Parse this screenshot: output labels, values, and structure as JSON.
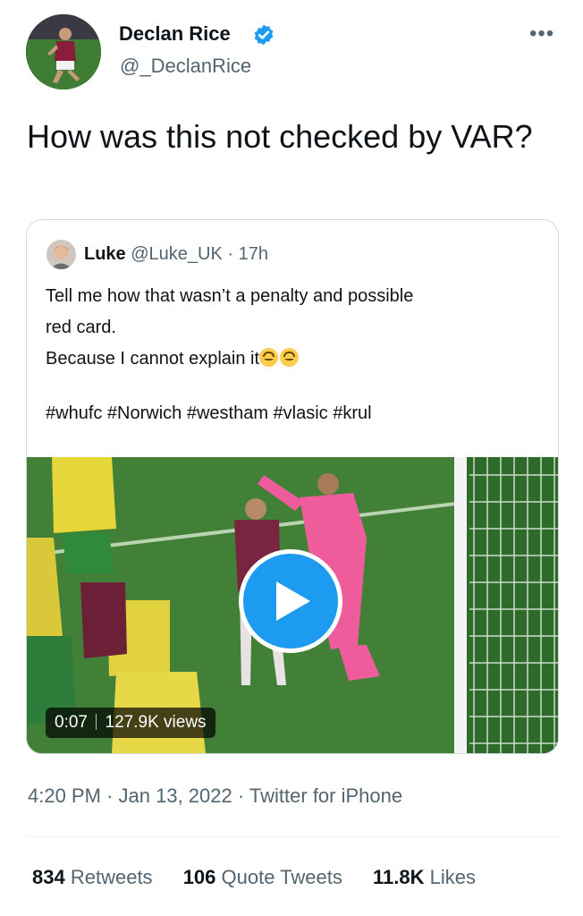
{
  "tweet": {
    "author": {
      "name": "Declan Rice",
      "handle": "@_DeclanRice",
      "verified": true
    },
    "text": "How was this not checked by VAR?",
    "more_icon": "ellipsis-icon"
  },
  "quote": {
    "author": {
      "name": "Luke",
      "handle": "@Luke_UK",
      "separator": "·",
      "time": "17h"
    },
    "lines": [
      "Tell me how that wasn’t a penalty and possible",
      "red card.",
      "Because I cannot explain it"
    ],
    "emoji": [
      "upside-down-face-emoji",
      "upside-down-face-emoji"
    ],
    "hashtags": "#whufc #Norwich #westham #vlasic #krul",
    "video": {
      "duration": "0:07",
      "views": "127.9K views",
      "play_icon": "play-icon"
    }
  },
  "meta": {
    "time": "4:20 PM",
    "dot1": "·",
    "date": "Jan 13, 2022",
    "dot2": "·",
    "source": "Twitter for iPhone"
  },
  "stats": {
    "retweets": {
      "count": "834",
      "label": "Retweets"
    },
    "quotes": {
      "count": "106",
      "label": "Quote Tweets"
    },
    "likes": {
      "count": "11.8K",
      "label": "Likes"
    }
  },
  "colors": {
    "accent": "#1d9bf0",
    "text": "#0f1419",
    "secondary": "#536471",
    "border": "#cfd9de"
  }
}
